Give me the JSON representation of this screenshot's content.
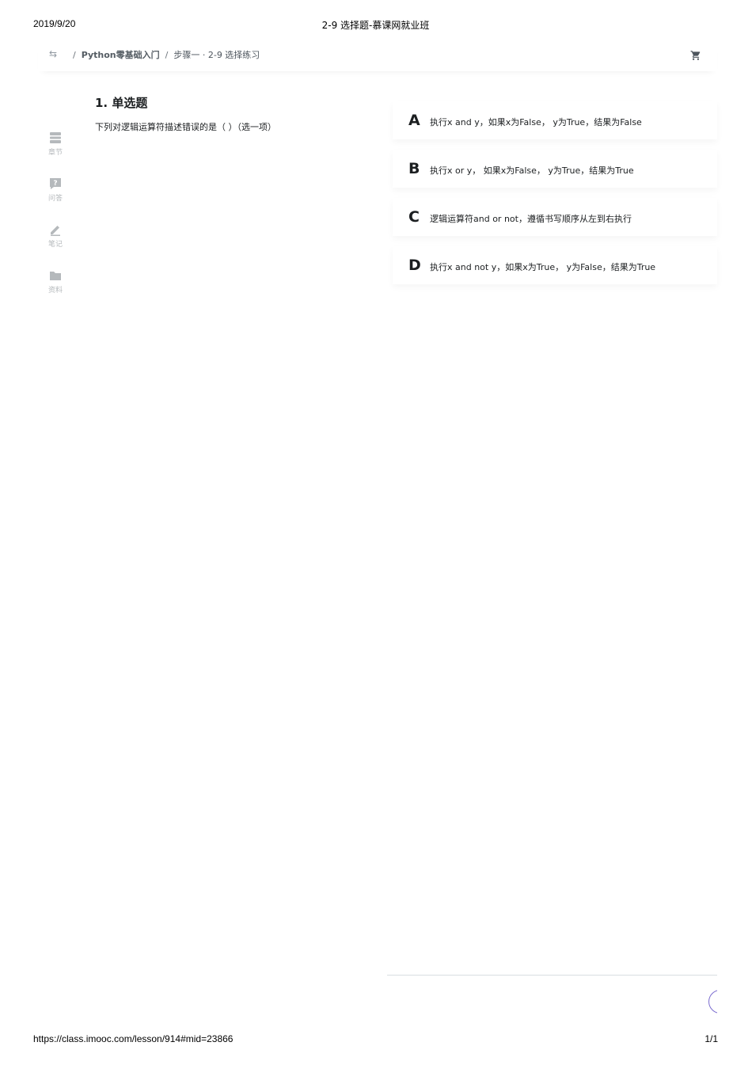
{
  "print_header": {
    "date": "2019/9/20",
    "title": "2-9 选择题-慕课网就业班"
  },
  "print_footer": {
    "url": "https://class.imooc.com/lesson/914#mid=23866",
    "page": "1/1"
  },
  "nav": {
    "switch_icon": "switch-icon",
    "sep": "/",
    "course": "Python零基础入门",
    "lesson": "步骤一 · 2-9 选择练习",
    "cart_icon": "cart-icon"
  },
  "sidebar": {
    "items": [
      {
        "label": "章节",
        "icon": "chapter-icon"
      },
      {
        "label": "问答",
        "icon": "question-icon"
      },
      {
        "label": "笔记",
        "icon": "pencil-icon"
      },
      {
        "label": "资料",
        "icon": "folder-icon"
      }
    ]
  },
  "question": {
    "title": "1. 单选题",
    "text": "下列对逻辑运算符描述错误的是（ ）（选一项）"
  },
  "options": [
    {
      "letter": "A",
      "text": "执行x and y，如果x为False， y为True，结果为False"
    },
    {
      "letter": "B",
      "text": "执行x or y， 如果x为False， y为True，结果为True"
    },
    {
      "letter": "C",
      "text": "逻辑运算符and or not，遵循书写顺序从左到右执行"
    },
    {
      "letter": "D",
      "text": "执行x and not y，如果x为True， y为False，结果为True"
    }
  ],
  "colors": {
    "accent": "#7b6ccf",
    "icon_gray": "#b5b9bc",
    "text": "#1c1f21"
  }
}
